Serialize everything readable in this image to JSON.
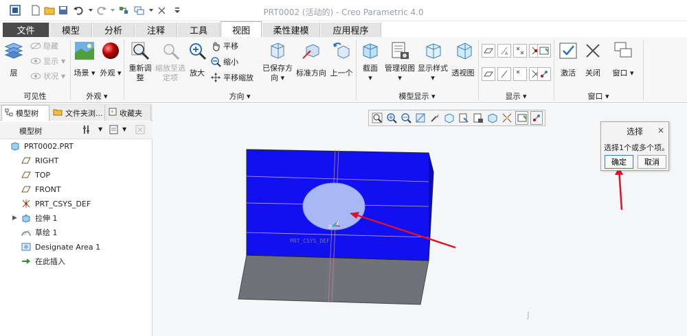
{
  "window": {
    "title": "PRT0002 (活动的) - Creo Parametric 4.0"
  },
  "tabs": [
    {
      "label": "文件"
    },
    {
      "label": "模型"
    },
    {
      "label": "分析"
    },
    {
      "label": "注释"
    },
    {
      "label": "工具"
    },
    {
      "label": "视图"
    },
    {
      "label": "柔性建模"
    },
    {
      "label": "应用程序"
    }
  ],
  "ribbon": {
    "visibility": {
      "layers": "层",
      "hide": "隐藏",
      "show": "显示",
      "status": "状况",
      "title": "可见性"
    },
    "appearance": {
      "scene": "场景",
      "appearance": "外观",
      "title": "外观"
    },
    "orientation": {
      "refit": [
        "重新调",
        "整"
      ],
      "zoom_selected": [
        "缩放至选",
        "定项"
      ],
      "zoom_in": "放大",
      "pan": "平移",
      "zoom_out": "缩小",
      "pan_zoom": "平移缩放",
      "saved_orient": [
        "已保存方",
        "向"
      ],
      "standard_orient": "标准方向",
      "previous": "上一个",
      "title": "方向"
    },
    "model_display": {
      "section": "截面",
      "manage_views": "管理视图",
      "display_style": "显示样式",
      "perspective": "透视图",
      "title": "模型显示"
    },
    "show": {
      "title": "显示"
    },
    "window": {
      "activate": "激活",
      "close": "关闭",
      "windows": "窗口",
      "title": "窗口"
    }
  },
  "left_panel": {
    "tabs": [
      "模型树",
      "文件夹浏...",
      "收藏夹"
    ],
    "header_label": "模型树",
    "tree": [
      {
        "label": "PRT0002.PRT",
        "icon": "part-icon"
      },
      {
        "label": "RIGHT",
        "icon": "datum-plane-icon"
      },
      {
        "label": "TOP",
        "icon": "datum-plane-icon"
      },
      {
        "label": "FRONT",
        "icon": "datum-plane-icon"
      },
      {
        "label": "PRT_CSYS_DEF",
        "icon": "csys-icon"
      },
      {
        "label": "拉伸 1",
        "icon": "extrude-icon"
      },
      {
        "label": "草绘 1",
        "icon": "sketch-icon"
      },
      {
        "label": "Designate Area 1",
        "icon": "designate-area-icon"
      },
      {
        "label": "在此插入",
        "icon": "insert-here-icon"
      }
    ]
  },
  "graphics": {
    "csys_label": "PRT_CSYS_DEF",
    "axis_y": "Y",
    "axis_z": "Z",
    "cursor_glyph": "J",
    "colors": {
      "top_face": "#1010f0",
      "side_face": "#6f7278",
      "selected_area": "#a8b8f5",
      "arrow": "#e0102a"
    }
  },
  "selection_dialog": {
    "title": "选择",
    "close_glyph": "×",
    "message": "选择1个或多个项。",
    "ok_label": "确定",
    "cancel_label": "取消"
  }
}
